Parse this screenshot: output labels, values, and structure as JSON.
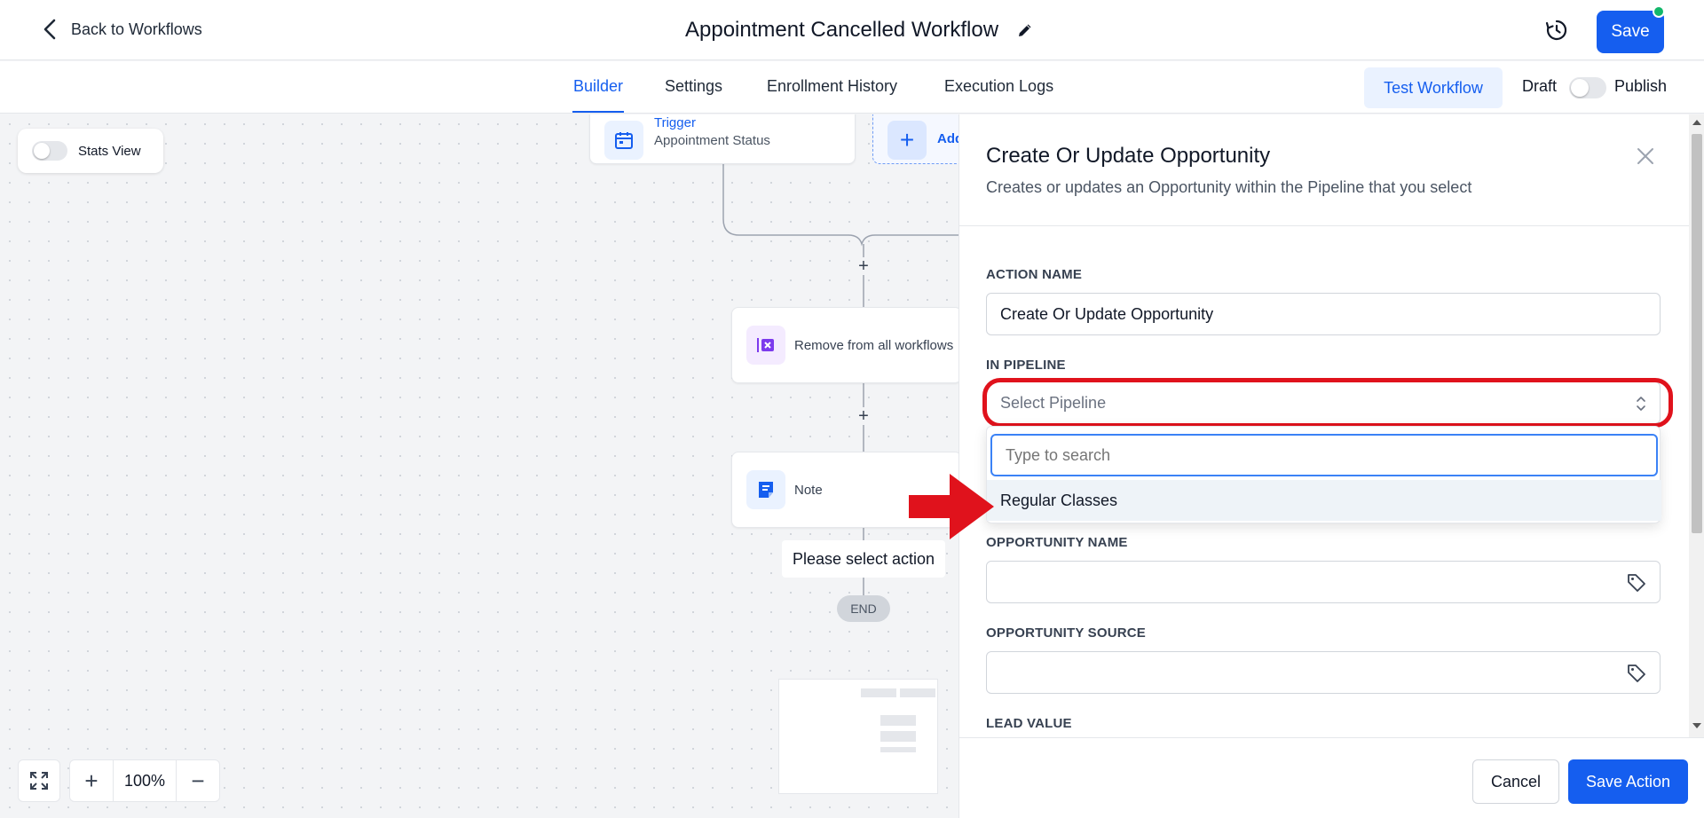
{
  "header": {
    "back_label": "Back to Workflows",
    "workflow_title": "Appointment Cancelled Workflow",
    "save_label": "Save"
  },
  "tabs": [
    {
      "label": "Builder",
      "active": true
    },
    {
      "label": "Settings",
      "active": false
    },
    {
      "label": "Enrollment History",
      "active": false
    },
    {
      "label": "Execution Logs",
      "active": false
    }
  ],
  "toolbar": {
    "test_label": "Test Workflow",
    "draft_label": "Draft",
    "publish_label": "Publish",
    "publish_on": false
  },
  "canvas": {
    "stats_label": "Stats View",
    "trigger_title": "Trigger",
    "trigger_sub": "Appointment Status",
    "add_trigger_label": "Add",
    "remove_label": "Remove from all workflows",
    "note_label": "Note",
    "select_action_label": "Please select action",
    "end_label": "END",
    "zoom_value": "100%"
  },
  "panel": {
    "title": "Create Or Update Opportunity",
    "subtitle": "Creates or updates an Opportunity within the Pipeline that you select",
    "action_name_label": "ACTION NAME",
    "action_name_value": "Create Or Update Opportunity",
    "pipeline_label": "IN PIPELINE",
    "pipeline_placeholder": "Select Pipeline",
    "search_placeholder": "Type to search",
    "pipeline_options": [
      "Regular Classes"
    ],
    "opportunity_name_label": "OPPORTUNITY NAME",
    "opportunity_source_label": "OPPORTUNITY SOURCE",
    "lead_value_label": "LEAD VALUE",
    "cancel_label": "Cancel",
    "save_action_label": "Save Action"
  },
  "colors": {
    "primary": "#155eef",
    "annotation_red": "#e0121c",
    "status_green": "#12b76a"
  }
}
